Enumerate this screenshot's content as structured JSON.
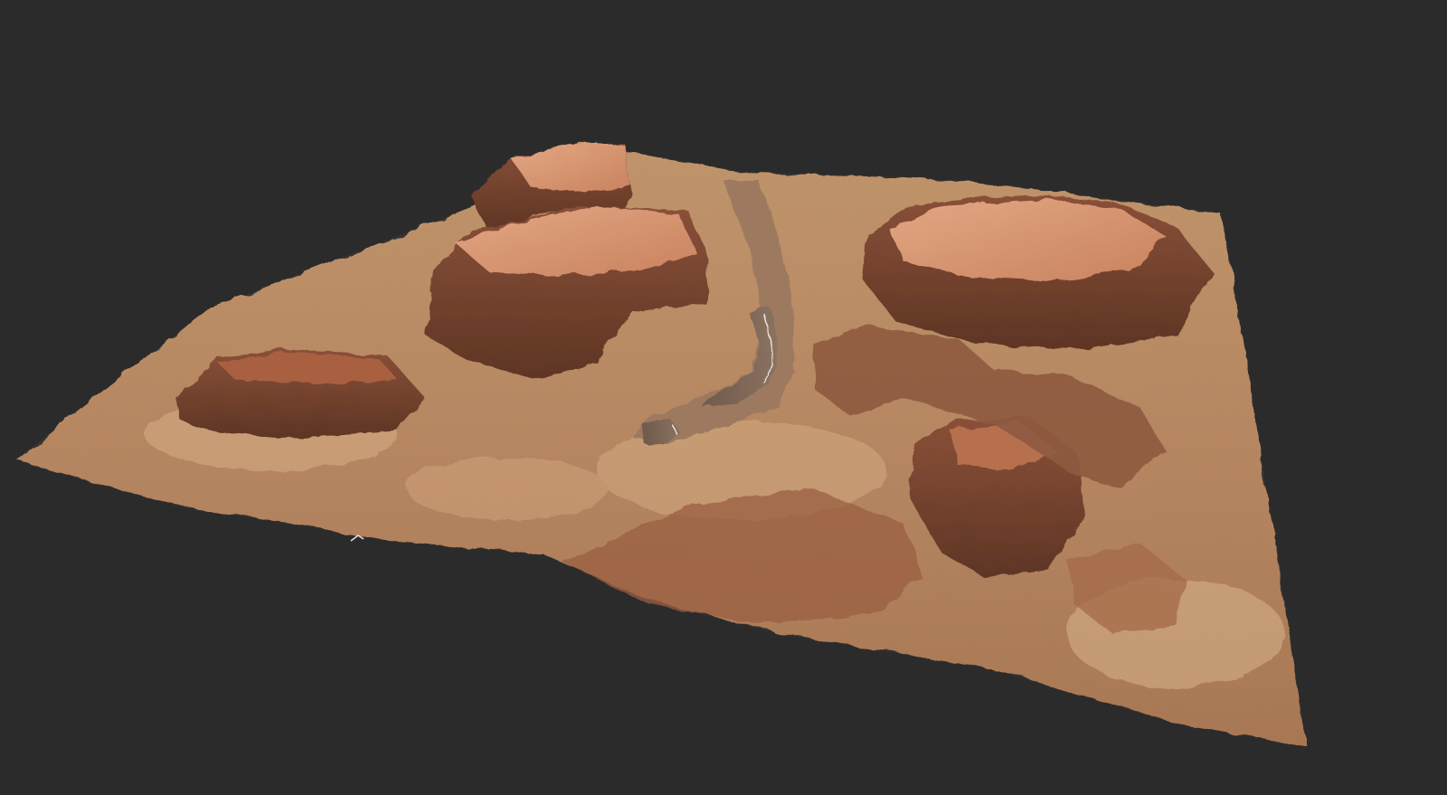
{
  "scene": {
    "subject": "",
    "colors": {
      "background": "#2b2b2b",
      "ground": "#b8875d",
      "ground_light": "#d2a57a",
      "mesa_top": "#d48e6a",
      "mesa_top_light": "#e0a37f",
      "cliff": "#7e4a32",
      "cliff_dark": "#5a3322",
      "shadow": "#6b3f2a",
      "water": "#7c6656",
      "water_highlight": "#e8e2dc"
    }
  }
}
